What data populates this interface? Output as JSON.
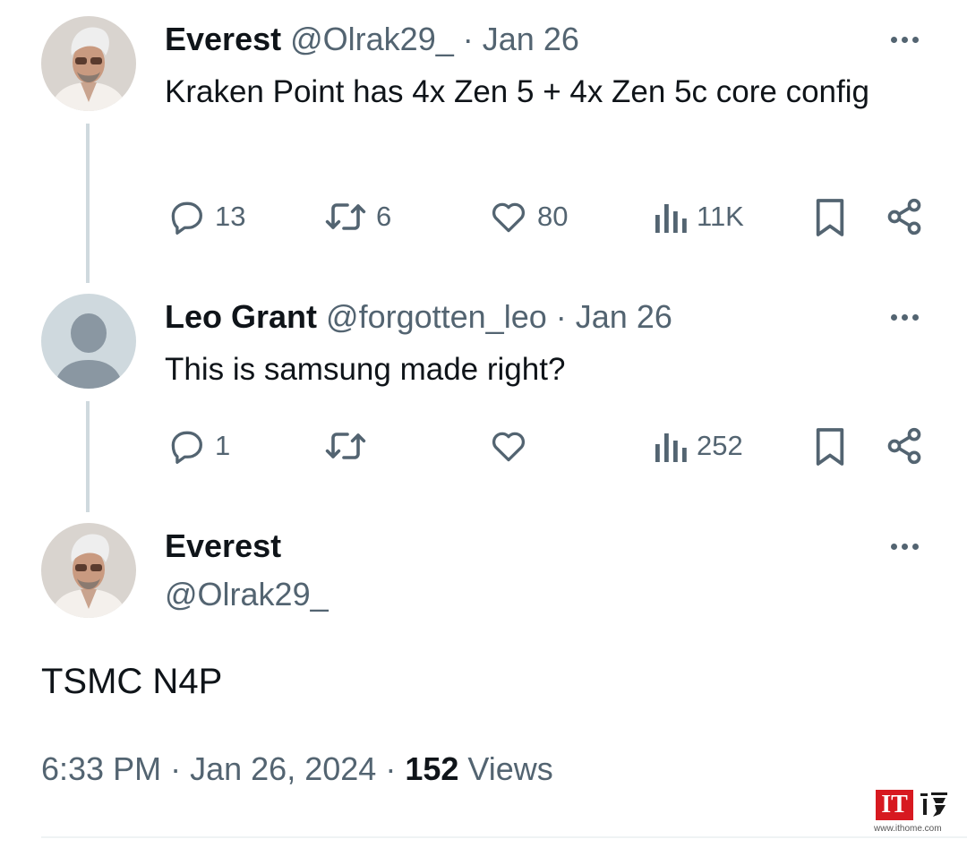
{
  "thread": {
    "tweets": [
      {
        "name": "Everest",
        "handle": "@Olrak29_",
        "date": "Jan 26",
        "text": "Kraken Point has 4x Zen 5 + 4x Zen 5c core config",
        "replies": "13",
        "reposts": "6",
        "likes": "80",
        "views": "11K"
      },
      {
        "name": "Leo Grant",
        "handle": "@forgotten_leo",
        "date": "Jan 26",
        "text": "This is samsung made right?",
        "replies": "1",
        "reposts": "",
        "likes": "",
        "views": "252"
      }
    ],
    "main": {
      "name": "Everest",
      "handle": "@Olrak29_",
      "text": "TSMC N4P",
      "time": "6:33 PM",
      "date": "Jan 26, 2024",
      "views_count": "152",
      "views_label": "Views"
    }
  },
  "watermark": {
    "brand": "IT",
    "site": "www.ithome.com"
  },
  "colors": {
    "text": "#0f1419",
    "muted": "#536471",
    "thread_line": "#cfd9de",
    "watermark": "#d71920"
  }
}
